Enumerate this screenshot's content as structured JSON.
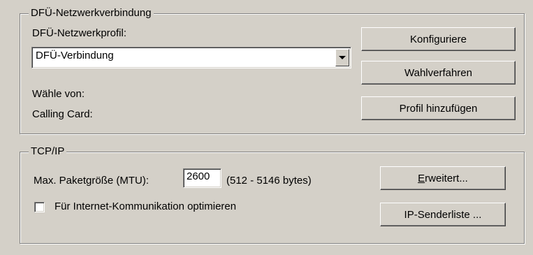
{
  "dialup": {
    "legend": "DFÜ-Netzwerkverbindung",
    "profile_label": "DFÜ-Netzwerkprofil:",
    "profile_selected": "DFÜ-Verbindung",
    "dial_from_label": "Wähle von:",
    "calling_card_label": "Calling Card:",
    "configure_button": "Konfiguriere",
    "dial_method_button": "Wahlverfahren",
    "add_profile_button": "Profil hinzufügen"
  },
  "tcpip": {
    "legend": "TCP/IP",
    "mtu_label": "Max. Paketgröße (MTU):",
    "mtu_value": "2600",
    "mtu_range": "(512 - 5146 bytes)",
    "optimize_label": "Für Internet-Kommunikation optimieren",
    "optimize_checked": false,
    "advanced_button_mnemonic": "E",
    "advanced_button_rest": "rweitert...",
    "sender_list_button": "IP-Senderliste ..."
  },
  "icons": {
    "combo_arrow": "chevron-down-icon"
  }
}
